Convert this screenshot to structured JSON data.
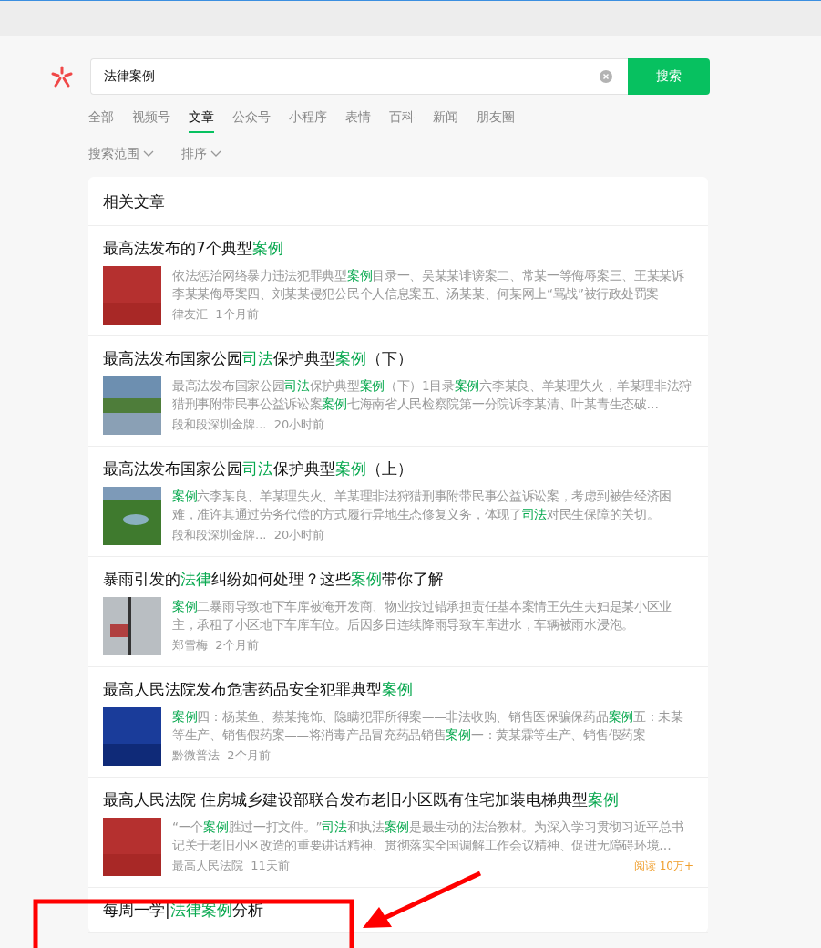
{
  "search": {
    "value": "法律案例",
    "button": "搜索"
  },
  "tabs": [
    {
      "label": "全部",
      "selected": false
    },
    {
      "label": "视频号",
      "selected": false
    },
    {
      "label": "文章",
      "selected": true
    },
    {
      "label": "公众号",
      "selected": false
    },
    {
      "label": "小程序",
      "selected": false
    },
    {
      "label": "表情",
      "selected": false
    },
    {
      "label": "百科",
      "selected": false
    },
    {
      "label": "新闻",
      "selected": false
    },
    {
      "label": "朋友圈",
      "selected": false
    }
  ],
  "filters": [
    {
      "label": "搜索范围"
    },
    {
      "label": "排序"
    }
  ],
  "section": {
    "title": "相关文章"
  },
  "articles": [
    {
      "title": [
        {
          "text": "最高法发布的7个典型",
          "highlight": false
        },
        {
          "text": "案例",
          "highlight": true
        }
      ],
      "thumbnail": {
        "kind": "banner_red"
      },
      "description": [
        {
          "text": "依法惩治网络暴力违法犯罪典型",
          "highlight": false
        },
        {
          "text": "案例",
          "highlight": true
        },
        {
          "text": "目录一、吴某某诽谤案二、常某一等侮辱案三、王某某诉李某某侮辱案四、刘某某侵犯公民个人信息案五、汤某某、何某网上“骂战”被行政处罚案",
          "highlight": false
        }
      ],
      "source": "律友汇",
      "time": "1个月前"
    },
    {
      "title": [
        {
          "text": "最高法发布国家公园",
          "highlight": false
        },
        {
          "text": "司法",
          "highlight": true
        },
        {
          "text": "保护典型",
          "highlight": false
        },
        {
          "text": "案例",
          "highlight": true
        },
        {
          "text": "（下）",
          "highlight": false
        }
      ],
      "thumbnail": {
        "kind": "photo_lake"
      },
      "description": [
        {
          "text": "最高法发布国家公园",
          "highlight": false
        },
        {
          "text": "司法",
          "highlight": true
        },
        {
          "text": "保护典型",
          "highlight": false
        },
        {
          "text": "案例",
          "highlight": true
        },
        {
          "text": "（下）1目录",
          "highlight": false
        },
        {
          "text": "案例",
          "highlight": true
        },
        {
          "text": "六李某良、羊某理失火，羊某理非法狩猎刑事附带民事公益诉讼案",
          "highlight": false
        },
        {
          "text": "案例",
          "highlight": true
        },
        {
          "text": "七海南省人民检察院第一分院诉李某清、叶某青生态破…",
          "highlight": false
        }
      ],
      "source": "段和段深圳金牌...",
      "time": "20小时前"
    },
    {
      "title": [
        {
          "text": "最高法发布国家公园",
          "highlight": false
        },
        {
          "text": "司法",
          "highlight": true
        },
        {
          "text": "保护典型",
          "highlight": false
        },
        {
          "text": "案例",
          "highlight": true
        },
        {
          "text": "（上）",
          "highlight": false
        }
      ],
      "thumbnail": {
        "kind": "photo_park"
      },
      "description": [
        {
          "text": "案例",
          "highlight": true
        },
        {
          "text": "六李某良、羊某理失火、羊某理非法狩猎刑事附带民事公益诉讼案，考虑到被告经济困难，准许其通过劳务代偿的方式履行异地生态修复义务，体现了",
          "highlight": false
        },
        {
          "text": "司法",
          "highlight": true
        },
        {
          "text": "对民生保障的关切。",
          "highlight": false
        }
      ],
      "source": "段和段深圳金牌...",
      "time": "20小时前"
    },
    {
      "title": [
        {
          "text": "暴雨引发的",
          "highlight": false
        },
        {
          "text": "法律",
          "highlight": true
        },
        {
          "text": "纠纷如何处理？这些",
          "highlight": false
        },
        {
          "text": "案例",
          "highlight": true
        },
        {
          "text": "带你了解",
          "highlight": false
        }
      ],
      "thumbnail": {
        "kind": "photo_rain"
      },
      "description": [
        {
          "text": "案例",
          "highlight": true
        },
        {
          "text": "二暴雨导致地下车库被淹开发商、物业按过错承担责任基本案情王先生夫妇是某小区业主，承租了小区地下车库车位。后因多日连续降雨导致车库进水，车辆被雨水浸泡。",
          "highlight": false
        }
      ],
      "source": "郑雪梅",
      "time": "2个月前"
    },
    {
      "title": [
        {
          "text": "最高人民法院发布危害药品安全犯罪典型",
          "highlight": false
        },
        {
          "text": "案例",
          "highlight": true
        }
      ],
      "thumbnail": {
        "kind": "banner_blue"
      },
      "description": [
        {
          "text": "案例",
          "highlight": true
        },
        {
          "text": "四：杨某鱼、蔡某掩饰、隐瞒犯罪所得案——非法收购、销售医保骗保药品",
          "highlight": false
        },
        {
          "text": "案例",
          "highlight": true
        },
        {
          "text": "五：未某等生产、销售假药案——将消毒产品冒充药品销售",
          "highlight": false
        },
        {
          "text": "案例",
          "highlight": true
        },
        {
          "text": "一：黄某霖等生产、销售假药案",
          "highlight": false
        }
      ],
      "source": "黔微普法",
      "time": "2个月前"
    },
    {
      "title": [
        {
          "text": "最高人民法院 住房城乡建设部联合发布老旧小区既有住宅加装电梯典型",
          "highlight": false
        },
        {
          "text": "案例",
          "highlight": true
        }
      ],
      "thumbnail": {
        "kind": "banner_red"
      },
      "description": [
        {
          "text": "“一个",
          "highlight": false
        },
        {
          "text": "案例",
          "highlight": true
        },
        {
          "text": "胜过一打文件。”",
          "highlight": false
        },
        {
          "text": "司法",
          "highlight": true
        },
        {
          "text": "和执法",
          "highlight": false
        },
        {
          "text": "案例",
          "highlight": true
        },
        {
          "text": "是最生动的法治教材。为深入学习贯彻习近平总书记关于老旧小区改造的重要讲话精神、贯彻落实全国调解工作会议精神、促进无障碍环境…",
          "highlight": false
        }
      ],
      "source": "最高人民法院",
      "time": "11天前",
      "reads": "阅读 10万+"
    },
    {
      "title": [
        {
          "text": "每周一学|",
          "highlight": false
        },
        {
          "text": "法律案例",
          "highlight": true
        },
        {
          "text": "分析",
          "highlight": false
        }
      ]
    }
  ]
}
